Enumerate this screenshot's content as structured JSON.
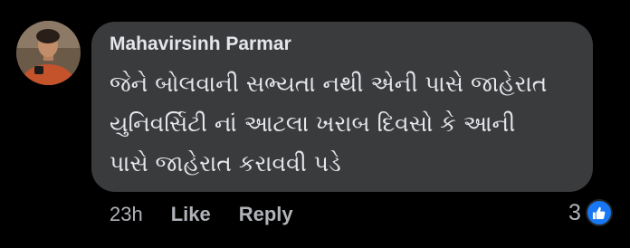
{
  "comment": {
    "author": "Mahavirsinh Parmar",
    "text_lines": [
      "જેને બોલવાની સભ્યતા નથી એની પાસે જાહેરાત",
      "યુનિવર્સિટી નાં આટલા ખરાબ દિવસો કે આની",
      "પાસે જાહેરાત કરાવવી પડે"
    ],
    "timestamp": "23h",
    "like_label": "Like",
    "reply_label": "Reply",
    "reaction_count": "3",
    "reaction_icon": "thumbs-up-icon",
    "colors": {
      "page_background": "#000000",
      "bubble_background": "#3a3b3c",
      "text": "#e4e6eb",
      "secondary_text": "#b0b3b8",
      "like_badge": "#1877f2"
    }
  }
}
